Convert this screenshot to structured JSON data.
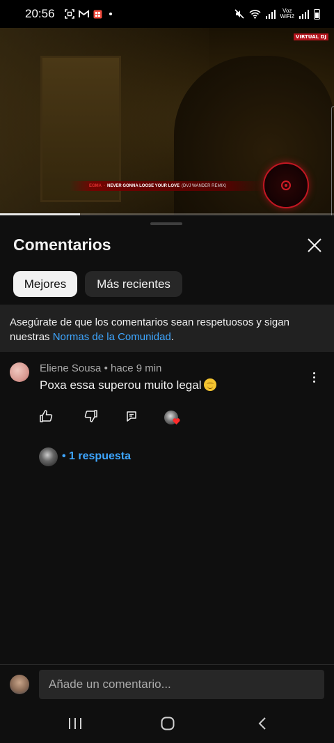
{
  "status_bar": {
    "time": "20:56",
    "left_icons": [
      "screenshot-icon",
      "gmail-icon",
      "app-icon",
      "dot-icon"
    ],
    "right_icons": [
      "mute-icon",
      "wifi-icon",
      "signal-icon",
      "vowifi-icon",
      "signal-icon",
      "battery-icon"
    ],
    "carrier_top": "Voz",
    "carrier_bottom": "WiFi2"
  },
  "video": {
    "badge": "VIRTUAL DJ",
    "song_artist": "EGMA",
    "song_sep": "-",
    "song_title": "NEVER GONNA LOOSE YOUR LOVE",
    "song_remix": "(DVJ WANDER REMIX)",
    "progress_fraction": 0.24
  },
  "comments_panel": {
    "title": "Comentarios",
    "close_icon": "close-icon",
    "filters": [
      {
        "label": "Mejores",
        "selected": true
      },
      {
        "label": "Más recientes",
        "selected": false
      }
    ],
    "notice": {
      "text": "Asegúrate de que los comentarios sean respetuosos y sigan nuestras ",
      "link": "Normas de la Comunidad",
      "suffix": "."
    },
    "comments": [
      {
        "author": "Eliene Sousa",
        "separator": "•",
        "time": "hace 9 min",
        "text": "Poxa essa superou muito legal",
        "emoji": "relieved-face",
        "actions": [
          "thumb-up-icon",
          "thumb-down-icon",
          "reply-icon"
        ],
        "creator_heart": true,
        "replies_label": "• 1 respuesta"
      }
    ],
    "compose": {
      "placeholder": "Añade un comentario..."
    }
  },
  "nav_bar": {
    "buttons": [
      "recents-icon",
      "home-icon",
      "back-icon"
    ]
  },
  "colors": {
    "background": "#0f0f0f",
    "link": "#3ea6ff",
    "chip_selected": "#f1f1f1",
    "chip_unselected": "#272727",
    "notice_bg": "#212121"
  }
}
